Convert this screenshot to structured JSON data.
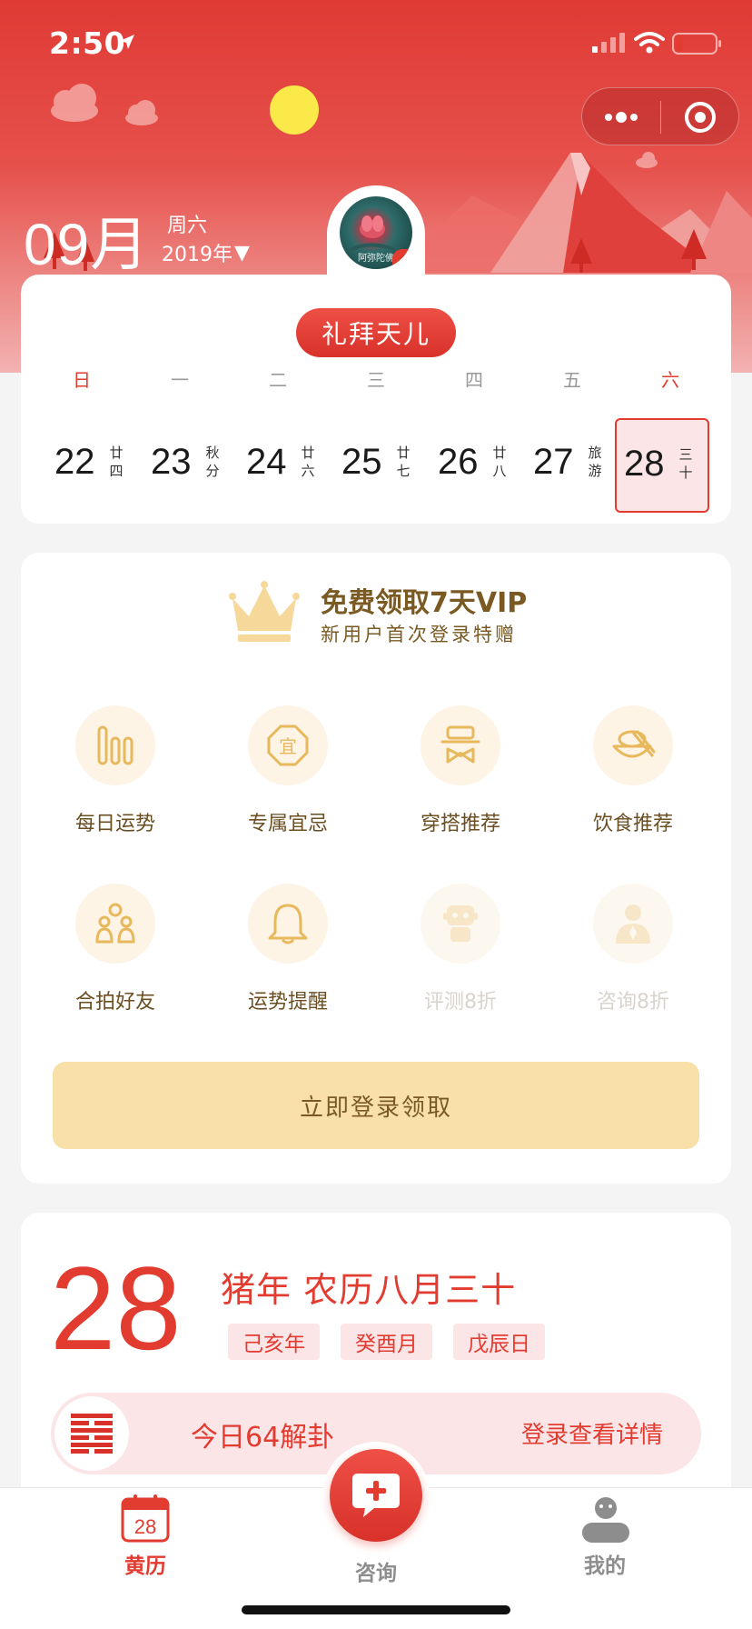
{
  "status_bar": {
    "time": "2:50"
  },
  "header": {
    "month": "09月",
    "weekday": "周六",
    "year": "2019年",
    "dropdown_glyph": "▼",
    "avatar_caption": "阿弥陀佛"
  },
  "calendar": {
    "festival": "礼拜天儿",
    "weekdays": [
      "日",
      "一",
      "二",
      "三",
      "四",
      "五",
      "六"
    ],
    "days": [
      {
        "num": "22",
        "lunar": [
          "廿",
          "四"
        ]
      },
      {
        "num": "23",
        "lunar": [
          "秋",
          "分"
        ]
      },
      {
        "num": "24",
        "lunar": [
          "廿",
          "六"
        ]
      },
      {
        "num": "25",
        "lunar": [
          "廿",
          "七"
        ]
      },
      {
        "num": "26",
        "lunar": [
          "廿",
          "八"
        ]
      },
      {
        "num": "27",
        "lunar": [
          "旅",
          "游"
        ]
      },
      {
        "num": "28",
        "lunar": [
          "三",
          "十"
        ]
      }
    ],
    "selected_index": 6
  },
  "vip": {
    "title": "免费领取7天VIP",
    "subtitle": "新用户首次登录特赠",
    "features": [
      {
        "label": "每日运势",
        "icon": "bars-icon",
        "enabled": true
      },
      {
        "label": "专属宜忌",
        "icon": "yi-seal-icon",
        "enabled": true
      },
      {
        "label": "穿搭推荐",
        "icon": "hat-bowtie-icon",
        "enabled": true
      },
      {
        "label": "饮食推荐",
        "icon": "bowl-icon",
        "enabled": true
      },
      {
        "label": "合拍好友",
        "icon": "friends-icon",
        "enabled": true
      },
      {
        "label": "运势提醒",
        "icon": "bell-icon",
        "enabled": true
      },
      {
        "label": "评测8折",
        "icon": "robot-icon",
        "enabled": false
      },
      {
        "label": "咨询8折",
        "icon": "advisor-icon",
        "enabled": false
      }
    ],
    "login_button": "立即登录领取"
  },
  "almanac": {
    "day": "28",
    "lunar_date": "猪年 农历八月三十",
    "ganzhi": [
      "己亥年",
      "癸酉月",
      "戊辰日"
    ],
    "hexagram_text": "今日64解卦",
    "hexagram_link": "登录查看详情"
  },
  "tabbar": {
    "tabs": [
      {
        "label": "黄历",
        "icon": "calendar-icon",
        "badge": "28",
        "active": true
      },
      {
        "label": "咨询",
        "icon": "consult-icon",
        "active": false
      },
      {
        "label": "我的",
        "icon": "profile-icon",
        "active": false
      }
    ]
  },
  "colors": {
    "primary_red": "#e23b30",
    "gold_text": "#7a5a22",
    "gold_button": "#f8e0a8",
    "pink_bg": "#fbe5e6"
  }
}
